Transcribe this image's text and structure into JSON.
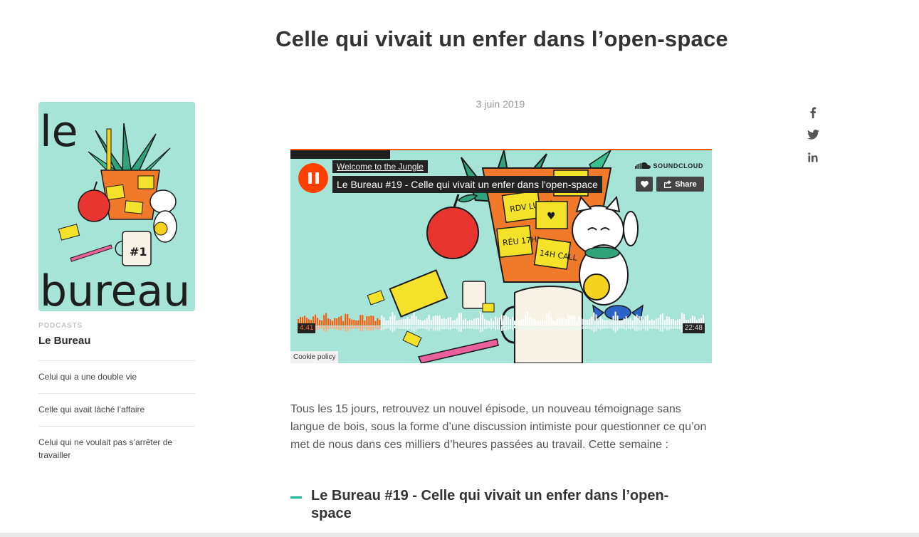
{
  "article": {
    "title": "Celle qui vivait un enfer dans l’open-space",
    "date": "3 juin 2019",
    "intro": "Tous les 15 jours, retrouvez un nouvel épisode, un nouveau témoignage sans langue de bois, sous la forme d’une discussion intimiste pour questionner ce qu’on met de nous dans ces milliers d’heures passées au travail. Cette semaine :",
    "episode_heading": "Le Bureau #19 - Celle qui vivait un enfer dans l’open-space"
  },
  "sidebar": {
    "cover_word_top": "le",
    "cover_word_bottom": "bureau",
    "kicker": "PODCASTS",
    "title": "Le Bureau",
    "items": [
      {
        "label": "Celui qui a une double vie"
      },
      {
        "label": "Celle qui avait lâché l’affaire"
      },
      {
        "label": "Celui qui ne voulait pas s’arrêter de travailler"
      }
    ]
  },
  "share": {
    "icons": [
      "facebook-icon",
      "twitter-icon",
      "linkedin-icon"
    ]
  },
  "player": {
    "user": "Welcome to the Jungle",
    "track": "Le Bureau #19 - Celle qui vivait un enfer dans l'open-space",
    "brand": "SOUNDCLOUD",
    "share_label": "Share",
    "current_time": "4:41",
    "total_time": "22:48",
    "progress": 0.206,
    "cookie_label": "Cookie policy",
    "colors": {
      "accent": "#ff5500",
      "artwork_bg": "#a5e4d6"
    }
  },
  "colors": {
    "dash": "#15b89a",
    "text": "#333333"
  }
}
